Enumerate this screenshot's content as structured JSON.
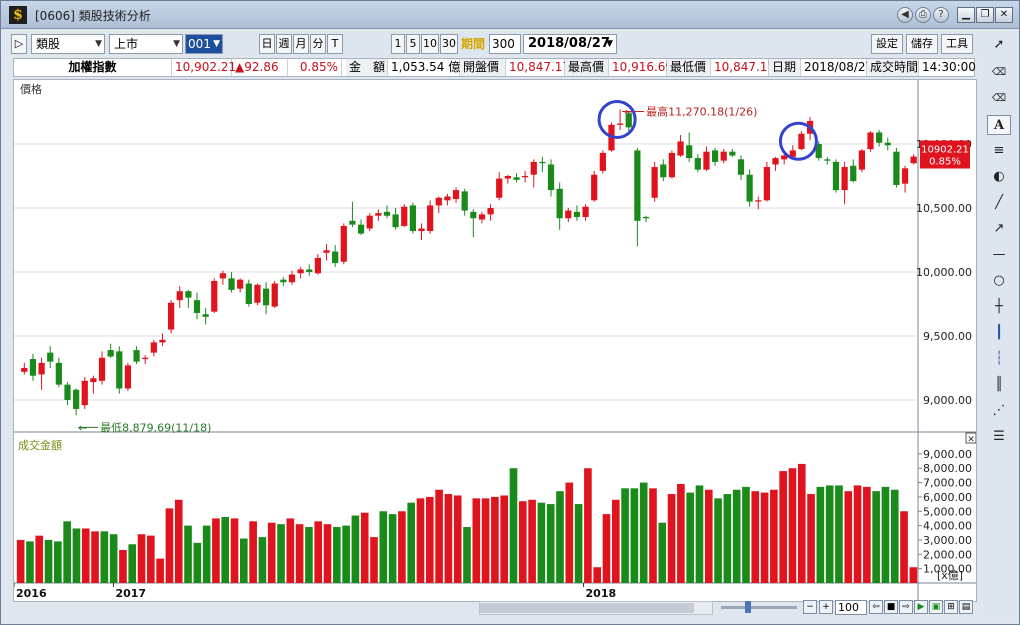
{
  "window": {
    "title": "[0606] 類股技術分析"
  },
  "toolbar": {
    "category_select": "類股",
    "market_select": "上市",
    "code_select": "001",
    "period_buttons": [
      "日",
      "週",
      "月",
      "分",
      "T"
    ],
    "num_buttons": [
      "1",
      "5",
      "10",
      "30"
    ],
    "period_label": "期間",
    "period_value": "300",
    "date_value": "2018/08/27",
    "settings_label": "設定",
    "save_label": "儲存",
    "tools_label": "工具"
  },
  "info": {
    "index_name": "加權指數",
    "index_value": "10,902.21",
    "change": "▲92.86",
    "change_pct": "0.85%",
    "amount_label": "金　額",
    "amount_value": "1,053.54 億",
    "open_label": "開盤價",
    "open_value": "10,847.17",
    "high_label": "最高價",
    "high_value": "10,916.69",
    "low_label": "最低價",
    "low_value": "10,847.17",
    "date_label": "日期",
    "date_value": "2018/08/27",
    "time_label": "成交時間",
    "time_value": "14:30:00"
  },
  "bottom": {
    "zoom_value": "100"
  },
  "chart_data": [
    {
      "type": "candlestick",
      "panel_label": "價格",
      "y_ticks": [
        "9,000.00",
        "9,500.00",
        "10,000.00",
        "10,500.00",
        "11,000.00"
      ],
      "y_tick_values": [
        9000,
        9500,
        10000,
        10500,
        11000
      ],
      "ylim": [
        8750,
        11500
      ],
      "current_label": "10902.21",
      "current_pct": "0.85%",
      "current_value": 10902.21,
      "annotation_high": "最高11,270.18(1/26)",
      "annotation_low": "最低8,879.69(11/18)",
      "up_color": "#e0141e",
      "down_color": "#1a8a1a",
      "candles": [
        {
          "o": 9220,
          "h": 9290,
          "l": 9200,
          "c": 9250
        },
        {
          "o": 9320,
          "h": 9360,
          "l": 9150,
          "c": 9190
        },
        {
          "o": 9200,
          "h": 9330,
          "l": 9080,
          "c": 9290
        },
        {
          "o": 9370,
          "h": 9420,
          "l": 9250,
          "c": 9300
        },
        {
          "o": 9290,
          "h": 9330,
          "l": 9100,
          "c": 9120
        },
        {
          "o": 9120,
          "h": 9140,
          "l": 8960,
          "c": 9000
        },
        {
          "o": 9080,
          "h": 9090,
          "l": 8880,
          "c": 8930
        },
        {
          "o": 8960,
          "h": 9180,
          "l": 8930,
          "c": 9150
        },
        {
          "o": 9140,
          "h": 9190,
          "l": 9050,
          "c": 9170
        },
        {
          "o": 9150,
          "h": 9380,
          "l": 9120,
          "c": 9330
        },
        {
          "o": 9390,
          "h": 9440,
          "l": 9330,
          "c": 9340
        },
        {
          "o": 9380,
          "h": 9420,
          "l": 9050,
          "c": 9090
        },
        {
          "o": 9090,
          "h": 9290,
          "l": 9070,
          "c": 9270
        },
        {
          "o": 9390,
          "h": 9420,
          "l": 9280,
          "c": 9300
        },
        {
          "o": 9320,
          "h": 9350,
          "l": 9280,
          "c": 9330
        },
        {
          "o": 9370,
          "h": 9470,
          "l": 9340,
          "c": 9450
        },
        {
          "o": 9450,
          "h": 9520,
          "l": 9420,
          "c": 9470
        },
        {
          "o": 9550,
          "h": 9780,
          "l": 9520,
          "c": 9760
        },
        {
          "o": 9780,
          "h": 9890,
          "l": 9720,
          "c": 9850
        },
        {
          "o": 9850,
          "h": 9860,
          "l": 9720,
          "c": 9800
        },
        {
          "o": 9780,
          "h": 9840,
          "l": 9630,
          "c": 9680
        },
        {
          "o": 9670,
          "h": 9720,
          "l": 9590,
          "c": 9650
        },
        {
          "o": 9690,
          "h": 9950,
          "l": 9680,
          "c": 9930
        },
        {
          "o": 9950,
          "h": 10010,
          "l": 9900,
          "c": 9990
        },
        {
          "o": 9950,
          "h": 10000,
          "l": 9840,
          "c": 9860
        },
        {
          "o": 9870,
          "h": 9950,
          "l": 9840,
          "c": 9940
        },
        {
          "o": 9910,
          "h": 9940,
          "l": 9730,
          "c": 9750
        },
        {
          "o": 9760,
          "h": 9910,
          "l": 9740,
          "c": 9900
        },
        {
          "o": 9870,
          "h": 9920,
          "l": 9670,
          "c": 9740
        },
        {
          "o": 9730,
          "h": 9930,
          "l": 9720,
          "c": 9910
        },
        {
          "o": 9940,
          "h": 9960,
          "l": 9890,
          "c": 9920
        },
        {
          "o": 9920,
          "h": 10010,
          "l": 9900,
          "c": 9980
        },
        {
          "o": 9990,
          "h": 10040,
          "l": 9950,
          "c": 10020
        },
        {
          "o": 10020,
          "h": 10060,
          "l": 9970,
          "c": 10000
        },
        {
          "o": 9990,
          "h": 10140,
          "l": 9980,
          "c": 10110
        },
        {
          "o": 10150,
          "h": 10220,
          "l": 10090,
          "c": 10170
        },
        {
          "o": 10160,
          "h": 10210,
          "l": 10040,
          "c": 10070
        },
        {
          "o": 10080,
          "h": 10380,
          "l": 10060,
          "c": 10360
        },
        {
          "o": 10400,
          "h": 10550,
          "l": 10350,
          "c": 10370
        },
        {
          "o": 10370,
          "h": 10410,
          "l": 10290,
          "c": 10300
        },
        {
          "o": 10340,
          "h": 10460,
          "l": 10320,
          "c": 10440
        },
        {
          "o": 10440,
          "h": 10490,
          "l": 10400,
          "c": 10460
        },
        {
          "o": 10470,
          "h": 10520,
          "l": 10420,
          "c": 10440
        },
        {
          "o": 10450,
          "h": 10500,
          "l": 10330,
          "c": 10350
        },
        {
          "o": 10360,
          "h": 10530,
          "l": 10350,
          "c": 10510
        },
        {
          "o": 10520,
          "h": 10540,
          "l": 10300,
          "c": 10320
        },
        {
          "o": 10320,
          "h": 10380,
          "l": 10250,
          "c": 10340
        },
        {
          "o": 10320,
          "h": 10560,
          "l": 10300,
          "c": 10520
        },
        {
          "o": 10520,
          "h": 10590,
          "l": 10460,
          "c": 10580
        },
        {
          "o": 10560,
          "h": 10610,
          "l": 10520,
          "c": 10590
        },
        {
          "o": 10570,
          "h": 10660,
          "l": 10540,
          "c": 10640
        },
        {
          "o": 10630,
          "h": 10650,
          "l": 10440,
          "c": 10480
        },
        {
          "o": 10470,
          "h": 10490,
          "l": 10270,
          "c": 10420
        },
        {
          "o": 10410,
          "h": 10470,
          "l": 10380,
          "c": 10450
        },
        {
          "o": 10450,
          "h": 10530,
          "l": 10400,
          "c": 10500
        },
        {
          "o": 10580,
          "h": 10780,
          "l": 10560,
          "c": 10730
        },
        {
          "o": 10730,
          "h": 10760,
          "l": 10690,
          "c": 10750
        },
        {
          "o": 10740,
          "h": 10770,
          "l": 10700,
          "c": 10720
        },
        {
          "o": 10740,
          "h": 10790,
          "l": 10700,
          "c": 10750
        },
        {
          "o": 10760,
          "h": 10880,
          "l": 10660,
          "c": 10860
        },
        {
          "o": 10860,
          "h": 10900,
          "l": 10780,
          "c": 10850
        },
        {
          "o": 10840,
          "h": 10880,
          "l": 10590,
          "c": 10640
        },
        {
          "o": 10650,
          "h": 10700,
          "l": 10330,
          "c": 10420
        },
        {
          "o": 10420,
          "h": 10500,
          "l": 10390,
          "c": 10480
        },
        {
          "o": 10470,
          "h": 10520,
          "l": 10400,
          "c": 10430
        },
        {
          "o": 10430,
          "h": 10530,
          "l": 10400,
          "c": 10510
        },
        {
          "o": 10560,
          "h": 10790,
          "l": 10550,
          "c": 10760
        },
        {
          "o": 10790,
          "h": 10950,
          "l": 10770,
          "c": 10930
        },
        {
          "o": 10950,
          "h": 11170,
          "l": 10940,
          "c": 11150
        },
        {
          "o": 11150,
          "h": 11270,
          "l": 11110,
          "c": 11160
        },
        {
          "o": 11240,
          "h": 11260,
          "l": 11100,
          "c": 11130
        },
        {
          "o": 10950,
          "h": 10970,
          "l": 10200,
          "c": 10400
        },
        {
          "o": 10430,
          "h": 10440,
          "l": 10390,
          "c": 10420
        },
        {
          "o": 10580,
          "h": 10860,
          "l": 10550,
          "c": 10820
        },
        {
          "o": 10840,
          "h": 10880,
          "l": 10710,
          "c": 10740
        },
        {
          "o": 10740,
          "h": 10950,
          "l": 10730,
          "c": 10930
        },
        {
          "o": 10910,
          "h": 11070,
          "l": 10900,
          "c": 11020
        },
        {
          "o": 10990,
          "h": 11090,
          "l": 10860,
          "c": 10890
        },
        {
          "o": 10890,
          "h": 10920,
          "l": 10780,
          "c": 10800
        },
        {
          "o": 10800,
          "h": 10980,
          "l": 10790,
          "c": 10940
        },
        {
          "o": 10950,
          "h": 10970,
          "l": 10830,
          "c": 10860
        },
        {
          "o": 10870,
          "h": 10960,
          "l": 10850,
          "c": 10940
        },
        {
          "o": 10940,
          "h": 10960,
          "l": 10900,
          "c": 10910
        },
        {
          "o": 10880,
          "h": 10910,
          "l": 10720,
          "c": 10760
        },
        {
          "o": 10760,
          "h": 10800,
          "l": 10510,
          "c": 10550
        },
        {
          "o": 10550,
          "h": 10590,
          "l": 10490,
          "c": 10560
        },
        {
          "o": 10560,
          "h": 10860,
          "l": 10550,
          "c": 10820
        },
        {
          "o": 10840,
          "h": 10900,
          "l": 10790,
          "c": 10890
        },
        {
          "o": 10880,
          "h": 10920,
          "l": 10840,
          "c": 10910
        },
        {
          "o": 10900,
          "h": 10990,
          "l": 10880,
          "c": 10950
        },
        {
          "o": 10960,
          "h": 11100,
          "l": 10950,
          "c": 11080
        },
        {
          "o": 11080,
          "h": 11210,
          "l": 11030,
          "c": 11180
        },
        {
          "o": 11000,
          "h": 11020,
          "l": 10870,
          "c": 10890
        },
        {
          "o": 10880,
          "h": 10900,
          "l": 10840,
          "c": 10870
        },
        {
          "o": 10860,
          "h": 10880,
          "l": 10620,
          "c": 10640
        },
        {
          "o": 10640,
          "h": 10860,
          "l": 10530,
          "c": 10820
        },
        {
          "o": 10830,
          "h": 10880,
          "l": 10700,
          "c": 10710
        },
        {
          "o": 10800,
          "h": 10960,
          "l": 10780,
          "c": 10950
        },
        {
          "o": 10960,
          "h": 11100,
          "l": 10940,
          "c": 11090
        },
        {
          "o": 11090,
          "h": 11110,
          "l": 10980,
          "c": 11010
        },
        {
          "o": 11010,
          "h": 11050,
          "l": 10950,
          "c": 10990
        },
        {
          "o": 10940,
          "h": 10970,
          "l": 10660,
          "c": 10680
        },
        {
          "o": 10690,
          "h": 10830,
          "l": 10620,
          "c": 10810
        },
        {
          "o": 10850,
          "h": 10920,
          "l": 10840,
          "c": 10902
        }
      ]
    },
    {
      "type": "bar",
      "panel_label": "成交金額",
      "unit_label": "[x億]",
      "y_ticks": [
        "1,000.00",
        "2,000.00",
        "3,000.00",
        "4,000.00",
        "5,000.00",
        "6,000.00",
        "7,000.00",
        "8,000.00",
        "9,000.00"
      ],
      "y_tick_values": [
        1000,
        2000,
        3000,
        4000,
        5000,
        6000,
        7000,
        8000,
        9000
      ],
      "ylim": [
        0,
        9200
      ],
      "values": [
        3000,
        2900,
        3300,
        3000,
        2900,
        4300,
        3800,
        3800,
        3600,
        3600,
        3400,
        2300,
        2700,
        3400,
        3300,
        1700,
        5200,
        5800,
        4000,
        2800,
        4000,
        4500,
        4600,
        4500,
        3100,
        4300,
        3200,
        4200,
        4100,
        4500,
        4100,
        3900,
        4300,
        4100,
        3900,
        4000,
        4700,
        4900,
        3200,
        5000,
        4800,
        5000,
        5600,
        5900,
        6000,
        6500,
        6200,
        6100,
        3900,
        5900,
        5900,
        6000,
        6100,
        8000,
        5700,
        5800,
        5600,
        5500,
        6400,
        7000,
        5500,
        8000,
        1100,
        4800,
        5800,
        6600,
        6600,
        7000,
        6600,
        4200,
        6200,
        6900,
        6300,
        6800,
        6500,
        5900,
        6200,
        6500,
        6700,
        6400,
        6300,
        6500,
        7800,
        8000,
        8300,
        6200,
        6700,
        6800,
        6800,
        6400,
        6800,
        6700,
        6400,
        6700,
        6500,
        5000,
        1100
      ],
      "date_labels": [
        "2016",
        "2017",
        "2018"
      ]
    }
  ]
}
